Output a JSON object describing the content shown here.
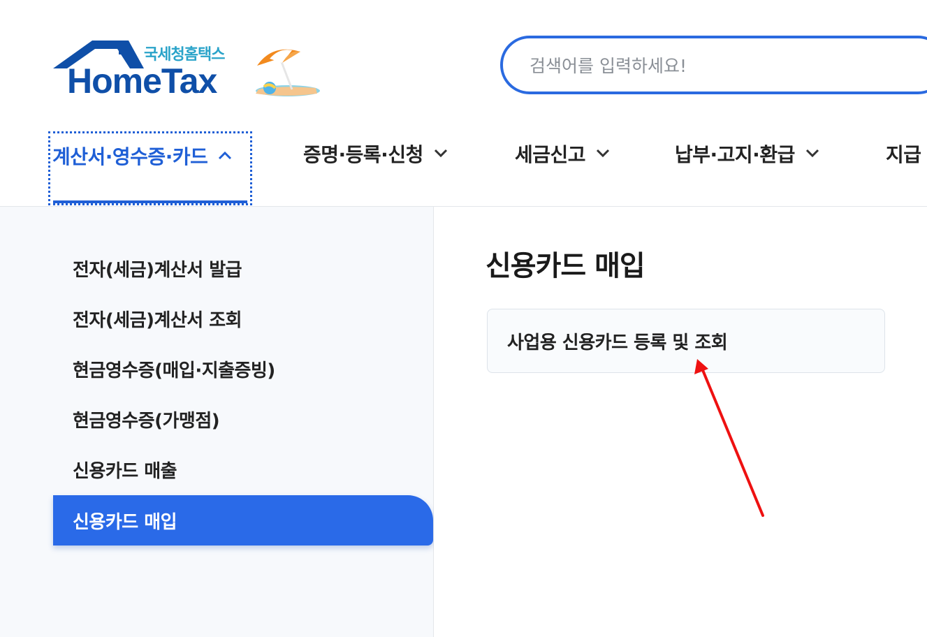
{
  "header": {
    "logo_sub": "국세청홈택스",
    "logo_main": "HomeTax",
    "search_placeholder": "검색어를 입력하세요!"
  },
  "nav": {
    "items": [
      {
        "label": "계산서·영수증·카드",
        "active": true
      },
      {
        "label": "증명·등록·신청",
        "active": false
      },
      {
        "label": "세금신고",
        "active": false
      },
      {
        "label": "납부·고지·환급",
        "active": false
      },
      {
        "label": "지급",
        "active": false
      }
    ]
  },
  "sidebar": {
    "items": [
      {
        "label": "전자(세금)계산서 발급"
      },
      {
        "label": "전자(세금)계산서 조회"
      },
      {
        "label": "현금영수증(매입·지출증빙)"
      },
      {
        "label": "현금영수증(가맹점)"
      },
      {
        "label": "신용카드 매출"
      },
      {
        "label": "신용카드 매입",
        "active": true
      }
    ]
  },
  "main": {
    "title": "신용카드 매입",
    "cards": [
      {
        "label": "사업용 신용카드 등록 및 조회"
      }
    ]
  },
  "colors": {
    "brand_blue": "#0f4fa8",
    "accent_blue": "#2a6ae8",
    "logo_teal": "#2aa3c9",
    "annotation_red": "#ee1111"
  }
}
